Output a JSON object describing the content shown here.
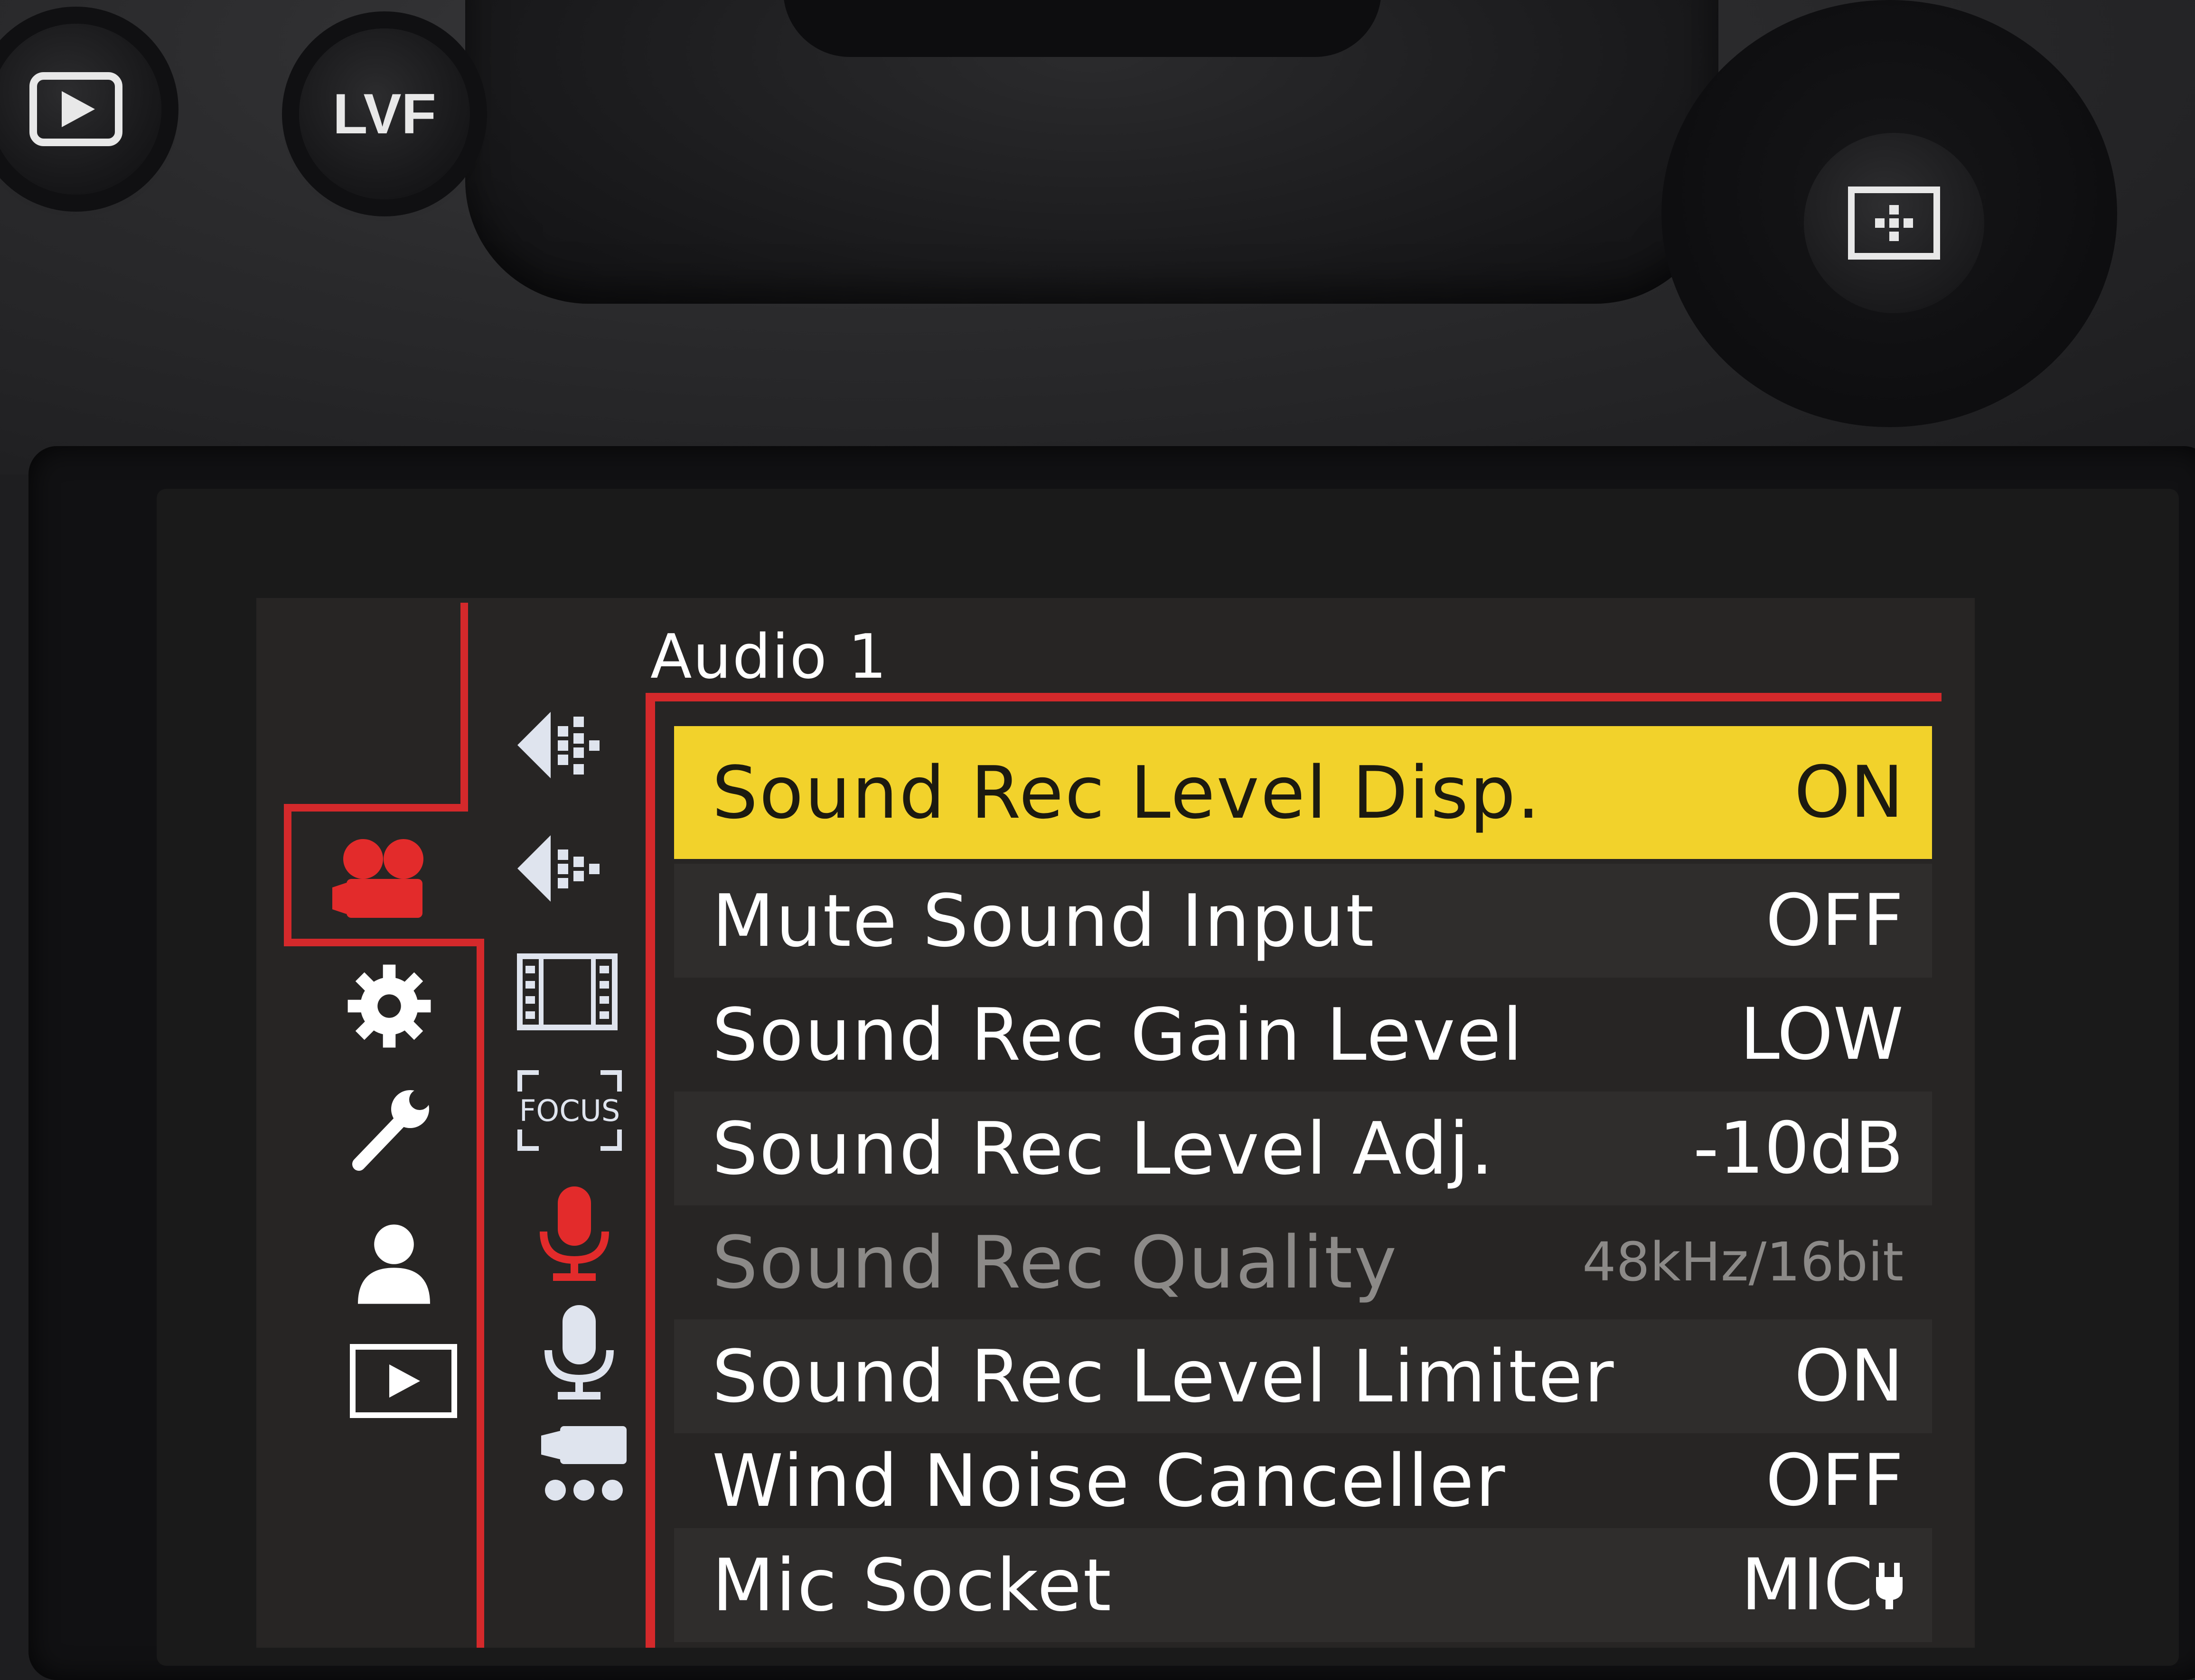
{
  "hardware": {
    "lvf_label": "LVF"
  },
  "menu": {
    "title": "Audio 1",
    "main_tabs": [
      {
        "icon": "video-camera-icon",
        "active": true
      },
      {
        "icon": "gear-icon",
        "active": false
      },
      {
        "icon": "wrench-icon",
        "active": false
      },
      {
        "icon": "person-icon",
        "active": false
      },
      {
        "icon": "playback-icon",
        "active": false
      }
    ],
    "sub_tabs": [
      {
        "icon": "exposure-1-icon",
        "active": false
      },
      {
        "icon": "exposure-2-icon",
        "active": false
      },
      {
        "icon": "film-strip-icon",
        "active": false
      },
      {
        "icon": "focus-icon",
        "label": "FOCUS",
        "active": false
      },
      {
        "icon": "microphone-icon",
        "active": true
      },
      {
        "icon": "microphone-2-icon",
        "active": false
      },
      {
        "icon": "video-others-icon",
        "active": false
      }
    ],
    "items": [
      {
        "label": "Sound Rec Level Disp.",
        "value": "ON"
      },
      {
        "label": "Mute Sound Input",
        "value": "OFF"
      },
      {
        "label": "Sound Rec Gain Level",
        "value": "LOW"
      },
      {
        "label": "Sound Rec Level Adj.",
        "value": "-10dB"
      },
      {
        "label": "Sound Rec Quality",
        "value": "48kHz/16bit"
      },
      {
        "label": "Sound Rec Level Limiter",
        "value": "ON"
      },
      {
        "label": "Wind Noise Canceller",
        "value": "OFF"
      },
      {
        "label": "Mic Socket",
        "value": "MIC"
      }
    ],
    "colors": {
      "accent": "#d4292b",
      "highlight": "#f2d22b",
      "text": "#ffffff",
      "disabled_text": "#8c8a88",
      "background": "#272524"
    }
  }
}
